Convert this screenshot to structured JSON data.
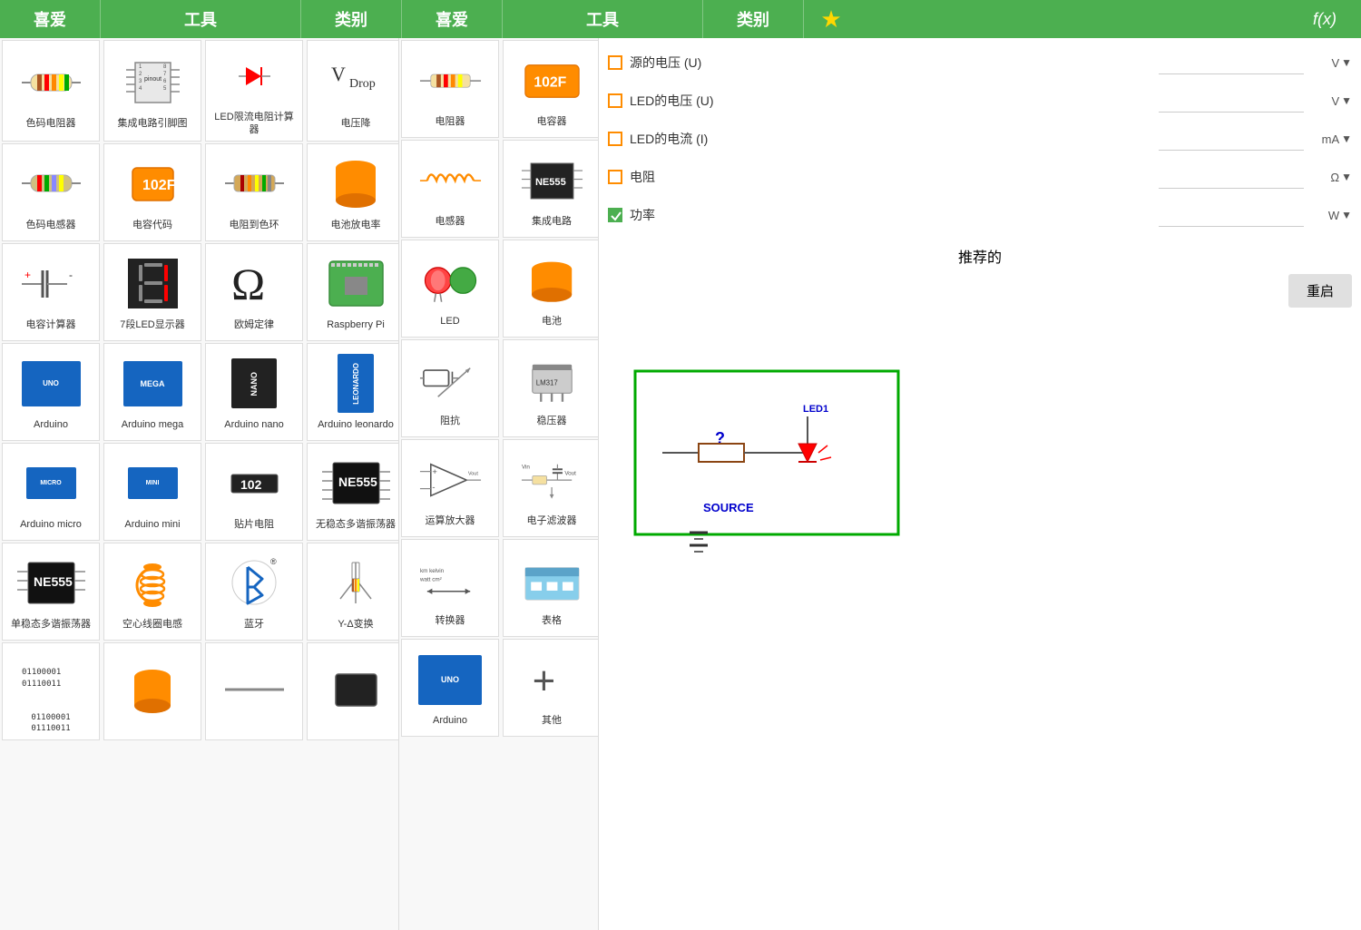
{
  "header": {
    "left_fav": "喜爱",
    "left_tools": "工具",
    "left_category": "类别",
    "right_fav": "喜爱",
    "right_tools": "工具",
    "right_category": "类别",
    "star_icon": "★",
    "fx_label": "f(x)"
  },
  "left_tools": [
    {
      "id": "color-resistor",
      "label": "色码电阻器"
    },
    {
      "id": "ic-pinout",
      "label": "集成电路引脚图"
    },
    {
      "id": "led-resistor",
      "label": "LED限流电阻计算器"
    },
    {
      "id": "voltage-drop",
      "label": "电压降"
    },
    {
      "id": "color-inductor",
      "label": "色码电感器"
    },
    {
      "id": "capacitor-code",
      "label": "电容代码"
    },
    {
      "id": "resistor-color",
      "label": "电阻到色环"
    },
    {
      "id": "battery-rate",
      "label": "电池放电率"
    },
    {
      "id": "capacitor-calc",
      "label": "电容计算器"
    },
    {
      "id": "7seg-display",
      "label": "7段LED显示器"
    },
    {
      "id": "ohm-law",
      "label": "欧姆定律"
    },
    {
      "id": "raspberry-pi",
      "label": "Raspberry Pi"
    },
    {
      "id": "arduino-uno",
      "label": "Arduino"
    },
    {
      "id": "arduino-mega",
      "label": "Arduino mega"
    },
    {
      "id": "arduino-nano",
      "label": "Arduino nano"
    },
    {
      "id": "arduino-leonardo",
      "label": "Arduino leonardo"
    },
    {
      "id": "arduino-micro",
      "label": "Arduino micro"
    },
    {
      "id": "arduino-mini",
      "label": "Arduino mini"
    },
    {
      "id": "smd-resistor",
      "label": "贴片电阻"
    },
    {
      "id": "astable-555",
      "label": "无稳态多谐振荡器"
    },
    {
      "id": "ne555-chip",
      "label": "单稳态多谐振荡器"
    },
    {
      "id": "air-coil",
      "label": "空心线圈电感"
    },
    {
      "id": "bluetooth",
      "label": "蓝牙"
    },
    {
      "id": "y-delta",
      "label": "Y-Δ变换"
    },
    {
      "id": "binary",
      "label": "01100001\n01110011"
    }
  ],
  "right_tools": [
    {
      "id": "resistor",
      "label": "电阻器"
    },
    {
      "id": "capacitor",
      "label": "电容器"
    },
    {
      "id": "inductor",
      "label": "电感器"
    },
    {
      "id": "ic",
      "label": "集成电路"
    },
    {
      "id": "led",
      "label": "LED"
    },
    {
      "id": "battery",
      "label": "电池"
    },
    {
      "id": "impedance",
      "label": "阻抗"
    },
    {
      "id": "regulator",
      "label": "稳压器"
    },
    {
      "id": "op-amp",
      "label": "运算放大器"
    },
    {
      "id": "filter",
      "label": "电子滤波器"
    },
    {
      "id": "converter",
      "label": "转换器"
    },
    {
      "id": "table",
      "label": "表格"
    },
    {
      "id": "arduino2",
      "label": "Arduino"
    },
    {
      "id": "other",
      "label": "其他"
    }
  ],
  "params": [
    {
      "id": "source-voltage",
      "label": "源的电压 (U)",
      "unit": "V",
      "checked": false,
      "value": ""
    },
    {
      "id": "led-voltage",
      "label": "LED的电压 (U)",
      "unit": "V",
      "checked": false,
      "value": ""
    },
    {
      "id": "led-current",
      "label": "LED的电流 (I)",
      "unit": "mA",
      "checked": false,
      "value": ""
    },
    {
      "id": "resistor-val",
      "label": "电阻",
      "unit": "Ω",
      "checked": false,
      "value": ""
    },
    {
      "id": "power-val",
      "label": "功率",
      "unit": "W",
      "checked": true,
      "value": ""
    }
  ],
  "recommended_label": "推荐的",
  "restart_button": "重启",
  "circuit": {
    "led_label": "LED1",
    "source_label": "SOURCE",
    "question_mark": "?"
  }
}
